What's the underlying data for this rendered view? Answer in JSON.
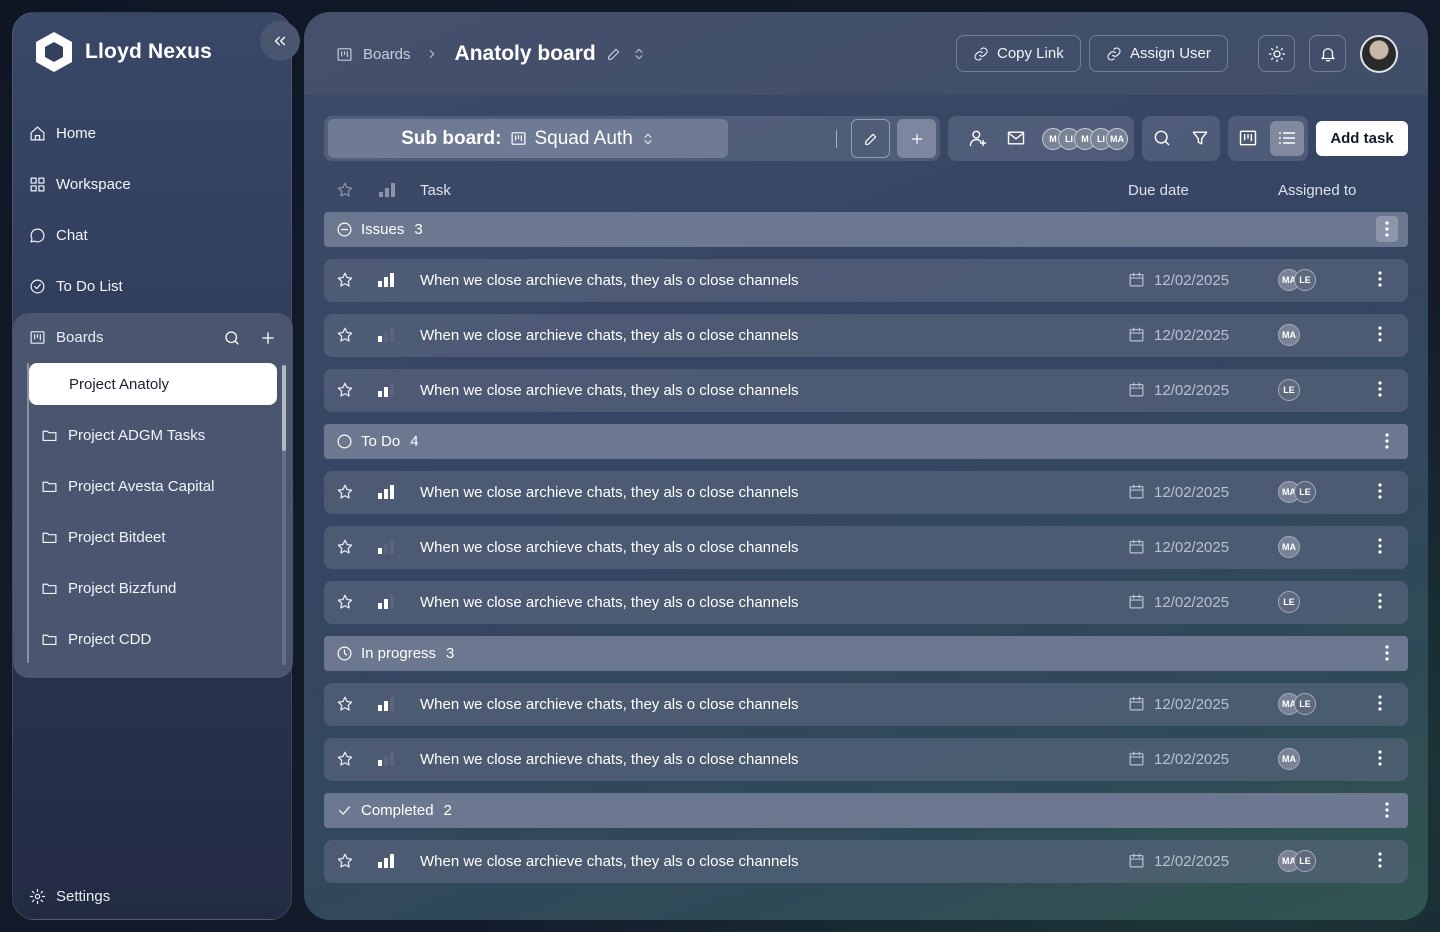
{
  "app": {
    "name": "Lloyd Nexus"
  },
  "sidebar": {
    "nav": [
      {
        "label": "Home",
        "icon": "home-icon"
      },
      {
        "label": "Workspace",
        "icon": "grid-icon"
      },
      {
        "label": "Chat",
        "icon": "chat-icon"
      },
      {
        "label": "To Do List",
        "icon": "check-circle-icon"
      }
    ],
    "boards": {
      "label": "Boards",
      "items": [
        {
          "label": "Project Anatoly",
          "active": true
        },
        {
          "label": "Project ADGM Tasks"
        },
        {
          "label": "Project Avesta Capital"
        },
        {
          "label": "Project Bitdeet"
        },
        {
          "label": "Project Bizzfund"
        },
        {
          "label": "Project CDD"
        }
      ]
    },
    "settings_label": "Settings"
  },
  "header": {
    "breadcrumb_root": "Boards",
    "board_title": "Anatoly board",
    "copy_link_label": "Copy Link",
    "assign_user_label": "Assign User"
  },
  "toolbar": {
    "subboard_prefix": "Sub board:",
    "subboard_name": "Squad Auth",
    "member_avatars": [
      "M",
      "LI",
      "M",
      "LI",
      "MA"
    ],
    "add_task_label": "Add task"
  },
  "table": {
    "columns": {
      "task": "Task",
      "due": "Due date",
      "assigned": "Assigned to"
    },
    "groups": [
      {
        "name": "Issues",
        "count": "3",
        "icon": "minus-circle-icon",
        "tasks": [
          {
            "title": "When we close archieve chats, they als o close channels",
            "due": "12/02/2025",
            "priority": "high",
            "assignees": [
              "MA",
              "LE"
            ]
          },
          {
            "title": "When we close archieve chats, they als o close channels",
            "due": "12/02/2025",
            "priority": "low",
            "assignees": [
              "MA"
            ]
          },
          {
            "title": "When we close archieve chats, they als o close channels",
            "due": "12/02/2025",
            "priority": "medium",
            "assignees": [
              "LE"
            ]
          }
        ]
      },
      {
        "name": "To Do",
        "count": "4",
        "icon": "circle-icon",
        "tasks": [
          {
            "title": "When we close archieve chats, they als o close channels",
            "due": "12/02/2025",
            "priority": "high",
            "assignees": [
              "MA",
              "LE"
            ]
          },
          {
            "title": "When we close archieve chats, they als o close channels",
            "due": "12/02/2025",
            "priority": "low",
            "assignees": [
              "MA"
            ]
          },
          {
            "title": "When we close archieve chats, they als o close channels",
            "due": "12/02/2025",
            "priority": "medium",
            "assignees": [
              "LE"
            ]
          }
        ]
      },
      {
        "name": "In progress",
        "count": "3",
        "icon": "clock-icon",
        "tasks": [
          {
            "title": "When we close archieve chats, they als o close channels",
            "due": "12/02/2025",
            "priority": "medium",
            "assignees": [
              "MA",
              "LE"
            ]
          },
          {
            "title": "When we close archieve chats, they als o close channels",
            "due": "12/02/2025",
            "priority": "low",
            "assignees": [
              "MA"
            ]
          }
        ]
      },
      {
        "name": "Completed",
        "count": "2",
        "icon": "check-icon",
        "tasks": [
          {
            "title": "When we close archieve chats, they als o close channels",
            "due": "12/02/2025",
            "priority": "high",
            "assignees": [
              "MA",
              "LE"
            ]
          }
        ]
      }
    ]
  }
}
